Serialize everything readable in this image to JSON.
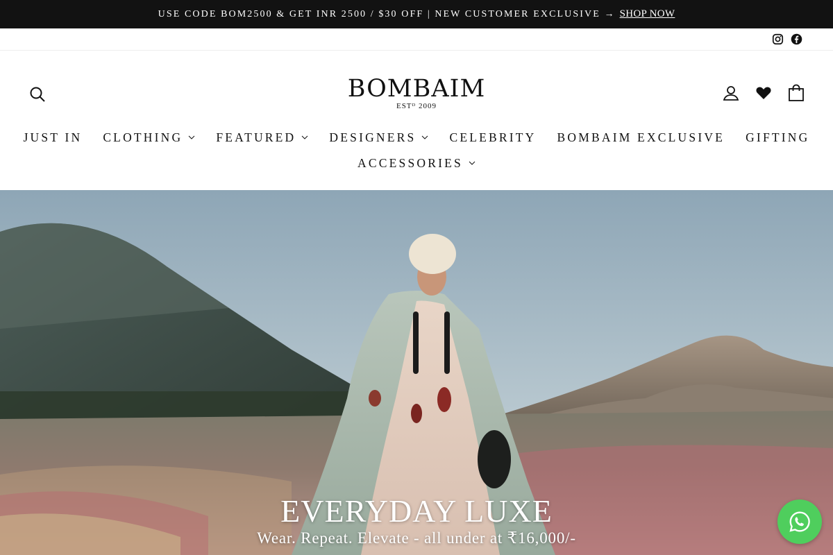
{
  "announcement": {
    "text": "USE CODE BOM2500 & GET INR 2500 / $30 OFF | NEW CUSTOMER EXCLUSIVE →",
    "link": "SHOP NOW"
  },
  "social": {
    "icons": [
      "instagram-icon",
      "facebook-icon"
    ]
  },
  "header": {
    "logo_name": "BOMBAIM",
    "logo_est": "ESTᴰ 2009",
    "icons": [
      "search-icon",
      "user-icon",
      "heart-icon",
      "bag-icon"
    ]
  },
  "nav": {
    "items": [
      {
        "label": "JUST IN"
      },
      {
        "label": "CLOTHING"
      },
      {
        "label": "FEATURED"
      },
      {
        "label": "DESIGNERS"
      },
      {
        "label": "CELEBRITY"
      },
      {
        "label": "BOMBAIM EXCLUSIVE"
      },
      {
        "label": "GIFTING"
      },
      {
        "label": "ACCESSORIES"
      }
    ]
  },
  "hero": {
    "title": "EVERYDAY LUXE",
    "subtitle": "Wear. Repeat. Elevate - all under at ₹16,000/-"
  },
  "colors": {
    "announcement_bg": "#121212",
    "whatsapp": "#4fce5d"
  }
}
